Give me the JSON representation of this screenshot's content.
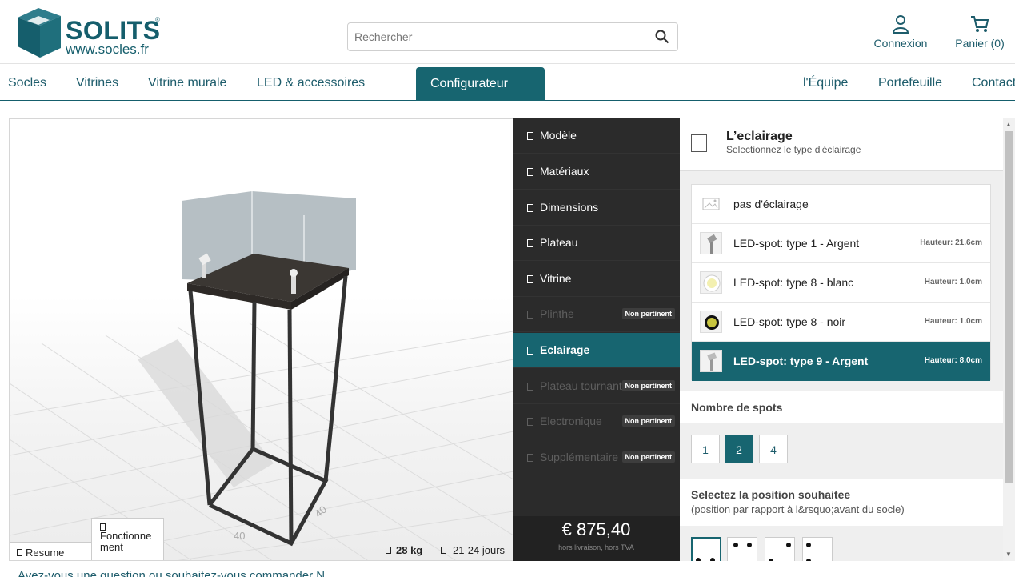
{
  "brand": {
    "name": "SOLITS",
    "reg": "®",
    "url": "www.socles.fr"
  },
  "search": {
    "placeholder": "Rechercher"
  },
  "account": {
    "label": "Connexion"
  },
  "cart": {
    "label": "Panier (0)"
  },
  "nav": {
    "left": [
      "Socles",
      "Vitrines",
      "Vitrine murale",
      "LED & accessoires"
    ],
    "active": "Configurateur",
    "right": [
      "l'Équipe",
      "Portefeuille",
      "Contact"
    ]
  },
  "viewer": {
    "resume_label": "Resume",
    "fonctionnement_label": "Fonctionne ment",
    "weight": "28 kg",
    "delivery": "21-24 jours",
    "dim_label_1": "40",
    "dim_label_2": "40"
  },
  "steps": [
    {
      "label": "Modèle",
      "state": "normal"
    },
    {
      "label": "Matériaux",
      "state": "normal"
    },
    {
      "label": "Dimensions",
      "state": "normal"
    },
    {
      "label": "Plateau",
      "state": "normal"
    },
    {
      "label": "Vitrine",
      "state": "normal"
    },
    {
      "label": "Plinthe",
      "state": "disabled",
      "badge": "Non pertinent"
    },
    {
      "label": "Eclairage",
      "state": "active"
    },
    {
      "label": "Plateau tournant",
      "state": "disabled",
      "badge": "Non pertinent"
    },
    {
      "label": "Electronique",
      "state": "disabled",
      "badge": "Non pertinent"
    },
    {
      "label": "Supplémentaire",
      "state": "disabled",
      "badge": "Non pertinent"
    }
  ],
  "price": {
    "amount": "€ 875,40",
    "note": "hors livraison, hors TVA"
  },
  "panel": {
    "title": "L’eclairage",
    "subtitle": "Selectionnez le type d'éclairage",
    "options": [
      {
        "label": "pas d'éclairage",
        "height": ""
      },
      {
        "label": "LED-spot: type 1 - Argent",
        "height": "Hauteur: 21.6cm"
      },
      {
        "label": "LED-spot: type 8 - blanc",
        "height": "Hauteur: 1.0cm"
      },
      {
        "label": "LED-spot: type 8 - noir",
        "height": "Hauteur: 1.0cm"
      },
      {
        "label": "LED-spot: type 9 - Argent",
        "height": "Hauteur: 8.0cm",
        "selected": true
      }
    ],
    "spots_title": "Nombre de spots",
    "spot_counts": [
      "1",
      "2",
      "4"
    ],
    "spot_selected": "2",
    "position_title": "Selectez la position souhaitee",
    "position_subtitle": "(position par rapport à l&rsquo;avant du socle)"
  },
  "footer": {
    "text": "Avez-vous une question ou souhaitez-vous commander  N"
  },
  "colors": {
    "primary": "#176570",
    "dark": "#2b2b2b"
  }
}
